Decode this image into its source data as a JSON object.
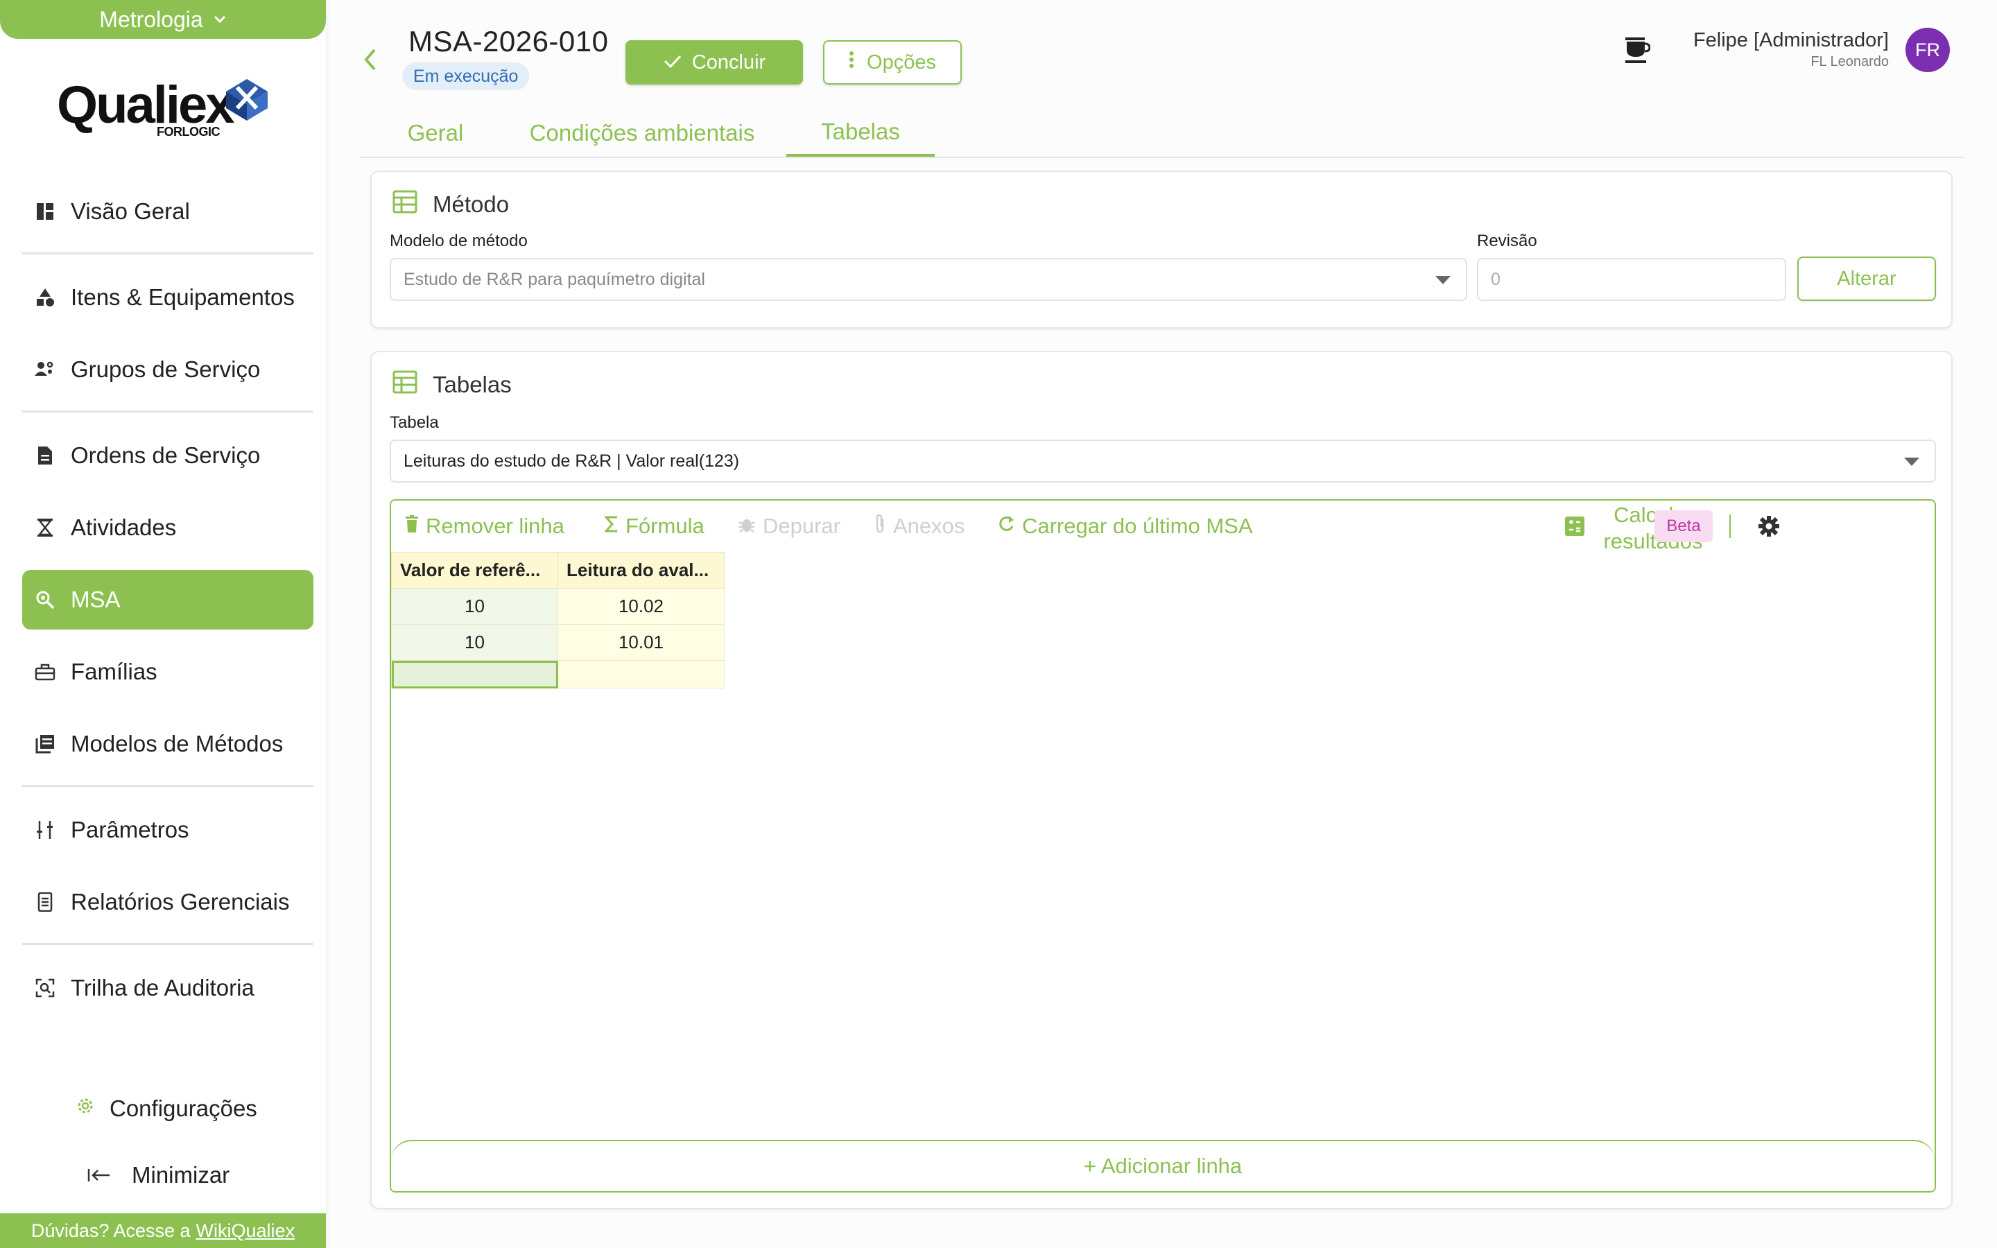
{
  "sidebar": {
    "module": "Metrologia",
    "logo_word": "Qualiex",
    "logo_sub": "FORLOGIC",
    "items": [
      {
        "label": "Visão Geral",
        "icon": "dashboard-icon"
      },
      {
        "label": "Itens & Equipamentos",
        "icon": "shapes-icon"
      },
      {
        "label": "Grupos de Serviço",
        "icon": "group-settings-icon"
      },
      {
        "label": "Ordens de Serviço",
        "icon": "document-icon"
      },
      {
        "label": "Atividades",
        "icon": "hourglass-icon"
      },
      {
        "label": "MSA",
        "icon": "search-zoom-icon"
      },
      {
        "label": "Famílias",
        "icon": "toolbox-icon"
      },
      {
        "label": "Modelos de Métodos",
        "icon": "library-icon"
      },
      {
        "label": "Parâmetros",
        "icon": "sliders-icon"
      },
      {
        "label": "Relatórios Gerenciais",
        "icon": "report-icon"
      },
      {
        "label": "Trilha de Auditoria",
        "icon": "scan-icon"
      }
    ],
    "settings_label": "Configurações",
    "minimize_label": "Minimizar",
    "help_text": "Dúvidas? Acesse a",
    "help_link": "WikiQualiex"
  },
  "header": {
    "record_id": "MSA-2026-010",
    "status": "Em execução",
    "finish_label": "Concluir",
    "options_label": "Opções",
    "user_name": "Felipe [Administrador]",
    "user_company": "FL Leonardo",
    "user_initials": "FR"
  },
  "tabs": [
    {
      "label": "Geral"
    },
    {
      "label": "Condições ambientais"
    },
    {
      "label": "Tabelas"
    }
  ],
  "method_card": {
    "title": "Método",
    "model_label": "Modelo de método",
    "model_value": "Estudo de R&R para paquímetro digital",
    "revision_label": "Revisão",
    "revision_value": "0",
    "change_label": "Alterar"
  },
  "tables_card": {
    "title": "Tabelas",
    "table_label": "Tabela",
    "table_value": "Leituras do estudo de R&R | Valor real(123)",
    "toolbar": {
      "remove_row": "Remover linha",
      "formula": "Fórmula",
      "debug": "Depurar",
      "attachments": "Anexos",
      "load_last": "Carregar do último MSA",
      "calculate": "Calcular resultados",
      "beta": "Beta"
    },
    "columns": [
      "Valor de referê...",
      "Leitura do aval..."
    ],
    "rows": [
      [
        "10",
        "10.02"
      ],
      [
        "10",
        "10.01"
      ]
    ],
    "add_row": "+ Adicionar linha"
  },
  "colors": {
    "accent": "#8cc152",
    "status_bg": "#e4eef8",
    "status_text": "#2f6fb3",
    "avatar": "#7b2fb0",
    "beta_bg": "#f8dcf2",
    "beta_text": "#c0399e"
  }
}
